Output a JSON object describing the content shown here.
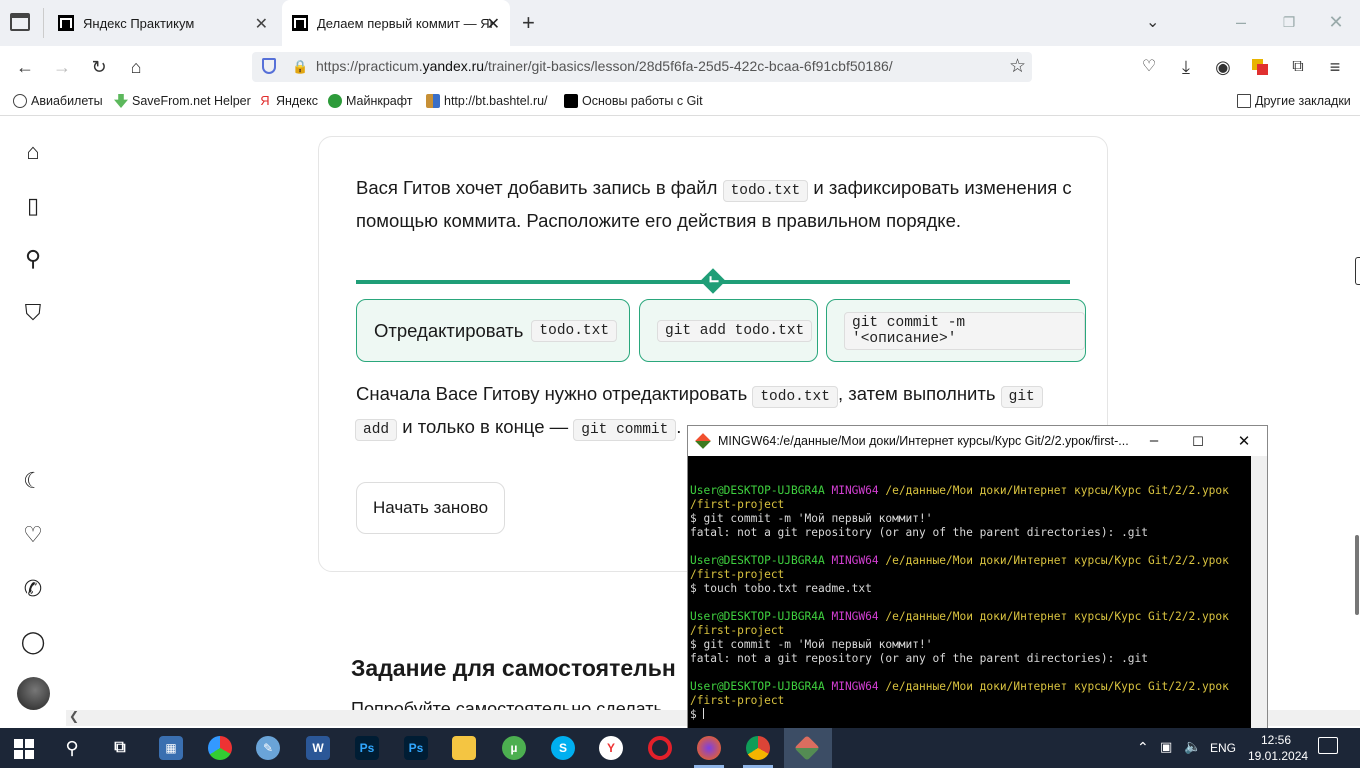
{
  "browser": {
    "tabs": [
      {
        "label": "Яндекс Практикум",
        "active": false
      },
      {
        "label": "Делаем первый коммит — Янд",
        "active": true
      }
    ],
    "new_tab_icon": "plus-icon",
    "url": {
      "prefix": "https://practicum.",
      "domain": "yandex.ru",
      "suffix": "/trainer/git-basics/lesson/28d5f6fa-25d5-422c-bcaa-6f91cbf50186/"
    },
    "bookmarks": [
      {
        "label": "Авиабилеты",
        "icon": "globe-icon",
        "color": "#444444"
      },
      {
        "label": "SaveFrom.net Helper",
        "icon": "savefrom-icon",
        "color": "#5cb85c"
      },
      {
        "label": "Яндекс",
        "icon": "yandex-icon",
        "color": "#e02b2b"
      },
      {
        "label": "Майнкрафт",
        "icon": "minecraft-icon",
        "color": "#2d9b3a"
      },
      {
        "label": "http://bt.bashtel.ru/",
        "icon": "bashtel-icon",
        "color": "#c79036"
      },
      {
        "label": "Основы работы с Git",
        "icon": "practicum-icon",
        "color": "#000000"
      }
    ],
    "other_bookmarks": "Другие закладки"
  },
  "lesson": {
    "task_text_1": "Вася Гитов хочет добавить запись в файл",
    "task_code_1": "todo.txt",
    "task_text_2": "и зафиксировать изменения с помощью коммита. Расположите его действия в правильном порядке.",
    "steps": [
      {
        "text": "Отредактировать",
        "code": "todo.txt"
      },
      {
        "text": "",
        "code": "git add todo.txt"
      },
      {
        "text": "",
        "code": "git commit -m '<описание>'"
      }
    ],
    "explain_1": "Сначала Васе Гитову нужно отредактировать",
    "explain_code_1": "todo.txt",
    "explain_2": ", затем выполнить",
    "explain_code_2a": "git",
    "explain_code_2b": "add",
    "explain_3": "и только в конце —",
    "explain_code_3": "git commit",
    "explain_4": ".",
    "restart_label": "Начать заново",
    "next_heading": "Задание для самостоятельн",
    "next_text": "Попробуйте самостоятельно сделать"
  },
  "terminal": {
    "title": "MINGW64:/e/данные/Мои доки/Интернет курсы/Курс Git/2/2.урок/first-...",
    "blocks": [
      {
        "user": "User@DESKTOP-UJBGR4A",
        "env": "MINGW64",
        "path": "/e/данные/Мои доки/Интернет курсы/Курс Git/2/2.урок",
        "path2": "/first-project",
        "cmd": "$ git commit -m 'Мой первый коммит!'",
        "out": "fatal: not a git repository (or any of the parent directories): .git"
      },
      {
        "user": "User@DESKTOP-UJBGR4A",
        "env": "MINGW64",
        "path": "/e/данные/Мои доки/Интернет курсы/Курс Git/2/2.урок",
        "path2": "/first-project",
        "cmd": "$ touch tobo.txt readme.txt",
        "out": ""
      },
      {
        "user": "User@DESKTOP-UJBGR4A",
        "env": "MINGW64",
        "path": "/e/данные/Мои доки/Интернет курсы/Курс Git/2/2.урок",
        "path2": "/first-project",
        "cmd": "$ git commit -m 'Мой первый коммит!'",
        "out": "fatal: not a git repository (or any of the parent directories): .git"
      },
      {
        "user": "User@DESKTOP-UJBGR4A",
        "env": "MINGW64",
        "path": "/e/данные/Мои доки/Интернет курсы/Курс Git/2/2.урок",
        "path2": "/first-project",
        "cmd": "$ ",
        "out": ""
      }
    ]
  },
  "taskbar": {
    "lang": "ENG",
    "time": "12:56",
    "date": "19.01.2024",
    "apps": [
      "windows-start-icon",
      "search-icon",
      "task-view-icon",
      "calculator-icon",
      "chromium-icon",
      "paint-icon",
      "word-icon",
      "photoshop-icon",
      "photoshop-icon",
      "file-explorer-icon",
      "utorrent-icon",
      "skype-icon",
      "yandex-browser-icon",
      "opera-icon",
      "firefox-icon",
      "chrome-icon",
      "git-bash-icon"
    ]
  },
  "colors": {
    "accent": "#1f9e77",
    "step_bg": "#eef8f3",
    "terminal_green": "#3fd13f",
    "terminal_magenta": "#d23fd2",
    "terminal_yellow": "#d8c23f"
  }
}
